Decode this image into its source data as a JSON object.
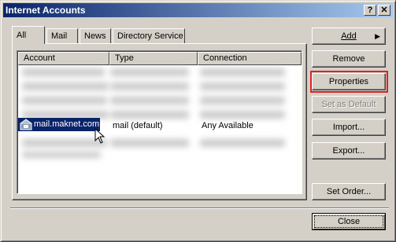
{
  "window": {
    "title": "Internet Accounts"
  },
  "title_buttons": {
    "help": "?",
    "close": "✕"
  },
  "tabs": [
    "All",
    "Mail",
    "News",
    "Directory Service"
  ],
  "columns": {
    "account": "Account",
    "type": "Type",
    "connection": "Connection"
  },
  "selected_account": {
    "name": "mail.maknet.com",
    "type": "mail (default)",
    "connection": "Any Available",
    "icon": "mail-account-icon"
  },
  "buttons": {
    "add": "Add",
    "add_arrow": "▶",
    "remove": "Remove",
    "properties": "Properties",
    "set_default": "Set as Default",
    "import": "Import...",
    "export": "Export...",
    "set_order": "Set Order...",
    "close": "Close"
  },
  "colors": {
    "titlebar_start": "#0a246a",
    "titlebar_end": "#a6caf0",
    "selection": "#0a246a",
    "highlight": "#e02020"
  }
}
